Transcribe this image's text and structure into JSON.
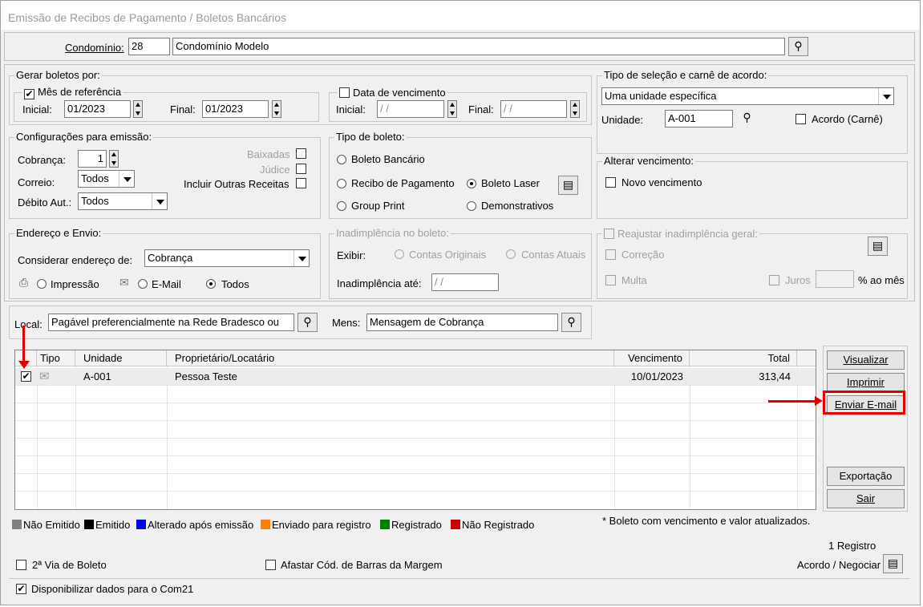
{
  "window": {
    "title": "Emissão de Recibos de Pagamento / Boletos Bancários"
  },
  "condominio": {
    "label": "Condomínio:",
    "code": "28",
    "name": "Condomínio Modelo"
  },
  "gerar": {
    "legend": "Gerar boletos por:",
    "mes_referencia": {
      "label": "Mês de referência",
      "checked": true,
      "inicial_label": "Inicial:",
      "inicial": "01/2023",
      "final_label": "Final:",
      "final": "01/2023"
    },
    "data_vencimento": {
      "label": "Data de vencimento",
      "checked": false,
      "inicial_label": "Inicial:",
      "inicial": " / /",
      "final_label": "Final:",
      "final": " / /"
    }
  },
  "tipo_selecao": {
    "legend": "Tipo de seleção e carnê de acordo:",
    "option": "Uma unidade específica",
    "unidade_label": "Unidade:",
    "unidade": "A-001",
    "acordo_label": "Acordo (Carnê)",
    "acordo_checked": false
  },
  "config": {
    "legend": "Configurações para emissão:",
    "cobranca_label": "Cobrança:",
    "cobranca": "1",
    "correio_label": "Correio:",
    "correio": "Todos",
    "debito_label": "Débito Aut.:",
    "debito": "Todos",
    "baixadas": "Baixadas",
    "judice": "Júdice",
    "outras_receitas": "Incluir Outras Receitas"
  },
  "tipo_boleto": {
    "legend": "Tipo de boleto:",
    "options": [
      "Boleto Bancário",
      "Recibo de Pagamento",
      "Boleto Laser",
      "Group Print",
      "Demonstrativos"
    ],
    "selected": "Boleto Laser"
  },
  "alterar_venc": {
    "legend": "Alterar vencimento:",
    "novo_label": "Novo vencimento",
    "checked": false
  },
  "endereco": {
    "legend": "Endereço e Envio:",
    "considerar_label": "Considerar endereço de:",
    "considerar": "Cobrança",
    "options": [
      "Impressão",
      "E-Mail",
      "Todos"
    ],
    "selected": "Todos"
  },
  "inadimplencia": {
    "legend": "Inadimplência no boleto:",
    "exibir_label": "Exibir:",
    "originais": "Contas Originais",
    "atuais": "Contas Atuais",
    "ate_label": "Inadimplência até:",
    "ate": " / /"
  },
  "reajustar": {
    "legend": "Reajustar inadimplência geral:",
    "correcao": "Correção",
    "multa": "Multa",
    "juros": "Juros",
    "juros_value": "",
    "ao_mes": "% ao mês"
  },
  "local": {
    "label": "Local:",
    "value": "Pagável preferencialmente na Rede Bradesco ou"
  },
  "mens": {
    "label": "Mens:",
    "value": "Mensagem de Cobrança"
  },
  "table": {
    "headers": [
      "Tipo",
      "Unidade",
      "Proprietário/Locatário",
      "Vencimento",
      "Total"
    ],
    "rows": [
      {
        "checked": true,
        "unidade": "A-001",
        "proprietario": "Pessoa Teste",
        "vencimento": "10/01/2023",
        "total": "313,44"
      }
    ]
  },
  "buttons": {
    "visualizar": "Visualizar",
    "imprimir": "Imprimir",
    "enviar_email": "Enviar E-mail",
    "exportacao": "Exportação",
    "sair": "Sair"
  },
  "legend_items": [
    {
      "label": "Não Emitido",
      "color": "#808080"
    },
    {
      "label": "Emitido",
      "color": "#000000"
    },
    {
      "label": "Alterado após emissão",
      "color": "#0000ff"
    },
    {
      "label": "Enviado para registro",
      "color": "#ff8000"
    },
    {
      "label": "Registrado",
      "color": "#008000"
    },
    {
      "label": "Não Registrado",
      "color": "#cc0000"
    }
  ],
  "note": "* Boleto com vencimento e valor atualizados.",
  "registro_count": "1 Registro",
  "bottom": {
    "segunda_via": "2ª Via de Boleto",
    "segunda_via_checked": false,
    "afastar": "Afastar Cód. de Barras da Margem",
    "afastar_checked": false,
    "acordo_negociar": "Acordo / Negociar",
    "com21": "Disponibilizar dados para o Com21",
    "com21_checked": true
  },
  "annotation_color": "#e00000"
}
